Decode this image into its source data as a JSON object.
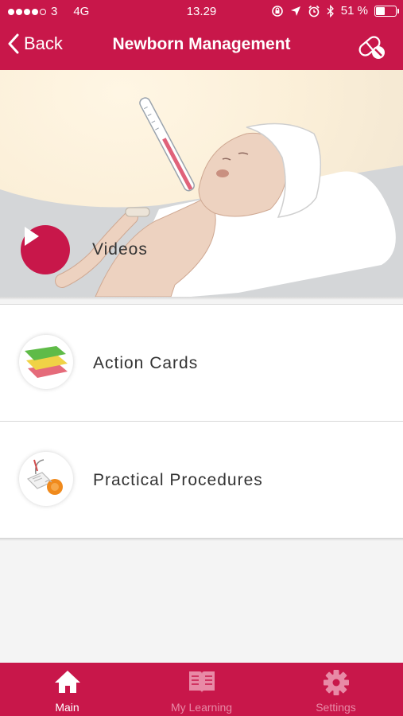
{
  "status_bar": {
    "carrier": "3",
    "network": "4G",
    "time": "13.29",
    "battery_percent": "51 %",
    "battery_level": 0.51
  },
  "nav": {
    "back_label": "Back",
    "title": "Newborn Management",
    "right_icon": "pill-toggle-icon"
  },
  "hero": {
    "label": "Videos",
    "icon": "play-icon"
  },
  "menu": {
    "items": [
      {
        "label": "Action Cards",
        "icon": "cards-stack-icon"
      },
      {
        "label": "Practical Procedures",
        "icon": "procedure-device-icon"
      }
    ]
  },
  "tab_bar": {
    "tabs": [
      {
        "label": "Main",
        "icon": "home-icon",
        "active": true
      },
      {
        "label": "My Learning",
        "icon": "book-icon",
        "active": false
      },
      {
        "label": "Settings",
        "icon": "gear-icon",
        "active": false
      }
    ]
  },
  "colors": {
    "accent": "#c8174a",
    "tab_inactive": "#e88aa6"
  }
}
